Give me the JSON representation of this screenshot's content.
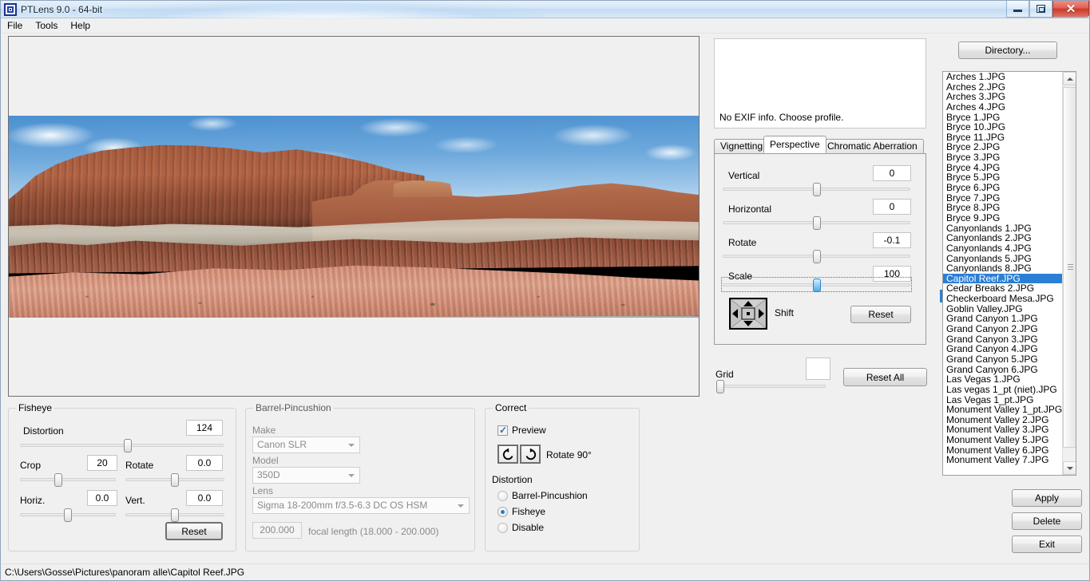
{
  "window": {
    "title": "PTLens 9.0 - 64-bit",
    "app_icon": "ptlens-square-icon",
    "minimize": "minimize-icon",
    "maximize": "restore-icon",
    "close": "✕"
  },
  "menubar": {
    "items": [
      "File",
      "Tools",
      "Help"
    ]
  },
  "preview": {
    "image_name": "Capitol Reef.JPG",
    "description": "Panorama of red sandstone cliffs at Capitol Reef under blue sky with clouds, rotated with black fill borders from perspective correction"
  },
  "exif": {
    "message": "No EXIF info. Choose profile."
  },
  "tabs": [
    {
      "label": "Vignetting",
      "active": false
    },
    {
      "label": "Perspective",
      "active": true
    },
    {
      "label": "Chromatic Aberration",
      "active": false
    }
  ],
  "perspective": {
    "vertical": {
      "label": "Vertical",
      "value": "0",
      "thumb_pct": 50
    },
    "horizontal": {
      "label": "Horizontal",
      "value": "0",
      "thumb_pct": 50
    },
    "rotate": {
      "label": "Rotate",
      "value": "-0.1",
      "thumb_pct": 50
    },
    "scale": {
      "label": "Scale",
      "value": "100",
      "thumb_pct": 50,
      "focused": true
    },
    "shift": {
      "label": "Shift",
      "icon": "shift-pad-icon"
    },
    "reset": "Reset"
  },
  "grid": {
    "label": "Grid",
    "value": "",
    "thumb_pct": 0,
    "reset_all": "Reset All"
  },
  "fisheye": {
    "title": "Fisheye",
    "distortion": {
      "label": "Distortion",
      "value": "124",
      "thumb_pct": 53
    },
    "crop": {
      "label": "Crop",
      "value": "20",
      "thumb_pct": 40
    },
    "rotate": {
      "label": "Rotate",
      "value": "0.0",
      "thumb_pct": 50
    },
    "horiz": {
      "label": "Horiz.",
      "value": "0.0",
      "thumb_pct": 50
    },
    "vert": {
      "label": "Vert.",
      "value": "0.0",
      "thumb_pct": 50
    },
    "reset": "Reset"
  },
  "barrel_pincushion": {
    "title": "Barrel-Pincushion",
    "disabled": true,
    "make_label": "Make",
    "make_value": "Canon SLR",
    "model_label": "Model",
    "model_value": "350D",
    "lens_label": "Lens",
    "lens_value": "Sigma  18-200mm f/3.5-6.3 DC OS HSM",
    "focal_value": "200.000",
    "focal_hint": "focal length (18.000 - 200.000)"
  },
  "correct": {
    "title": "Correct",
    "preview_label": "Preview",
    "preview_checked": true,
    "rotate_label": "Rotate 90°",
    "rotate_ccw_icon": "rotate-counterclockwise-icon",
    "rotate_cw_icon": "rotate-clockwise-icon",
    "distortion_label": "Distortion",
    "options": [
      {
        "label": "Barrel-Pincushion",
        "selected": false
      },
      {
        "label": "Fisheye",
        "selected": true
      },
      {
        "label": "Disable",
        "selected": false
      }
    ]
  },
  "sidebar": {
    "directory_button": "Directory...",
    "selected_file": "Capitol Reef.JPG",
    "files": [
      "Arches 1.JPG",
      "Arches 2.JPG",
      "Arches 3.JPG",
      "Arches 4.JPG",
      "Bryce 1.JPG",
      "Bryce 10.JPG",
      "Bryce 11.JPG",
      "Bryce 2.JPG",
      "Bryce 3.JPG",
      "Bryce 4.JPG",
      "Bryce 5.JPG",
      "Bryce 6.JPG",
      "Bryce 7.JPG",
      "Bryce 8.JPG",
      "Bryce 9.JPG",
      "Canyonlands 1.JPG",
      "Canyonlands 2.JPG",
      "Canyonlands 4.JPG",
      "Canyonlands 5.JPG",
      "Canyonlands 8.JPG",
      "Capitol Reef.JPG",
      "Cedar Breaks 2.JPG",
      "Checkerboard Mesa.JPG",
      "Goblin Valley.JPG",
      "Grand Canyon 1.JPG",
      "Grand Canyon 2.JPG",
      "Grand Canyon 3.JPG",
      "Grand Canyon 4.JPG",
      "Grand Canyon 5.JPG",
      "Grand Canyon 6.JPG",
      "Las Vegas 1.JPG",
      "Las vegas 1_pt (niet).JPG",
      "Las Vegas 1_pt.JPG",
      "Monument Valley 1_pt.JPG",
      "Monument Valley 2.JPG",
      "Monument Valley 3.JPG",
      "Monument Valley 5.JPG",
      "Monument Valley 6.JPG",
      "Monument Valley 7.JPG"
    ],
    "apply": "Apply",
    "delete": "Delete",
    "exit": "Exit"
  },
  "statusbar": {
    "path": "C:\\Users\\Gosse\\Pictures\\panoram alle\\Capitol Reef.JPG"
  },
  "colors": {
    "accent": "#2a7fd4",
    "titlebar": "#d3e4f6",
    "panel_bg": "#f0f0f0",
    "close_red": "#c9392a"
  }
}
